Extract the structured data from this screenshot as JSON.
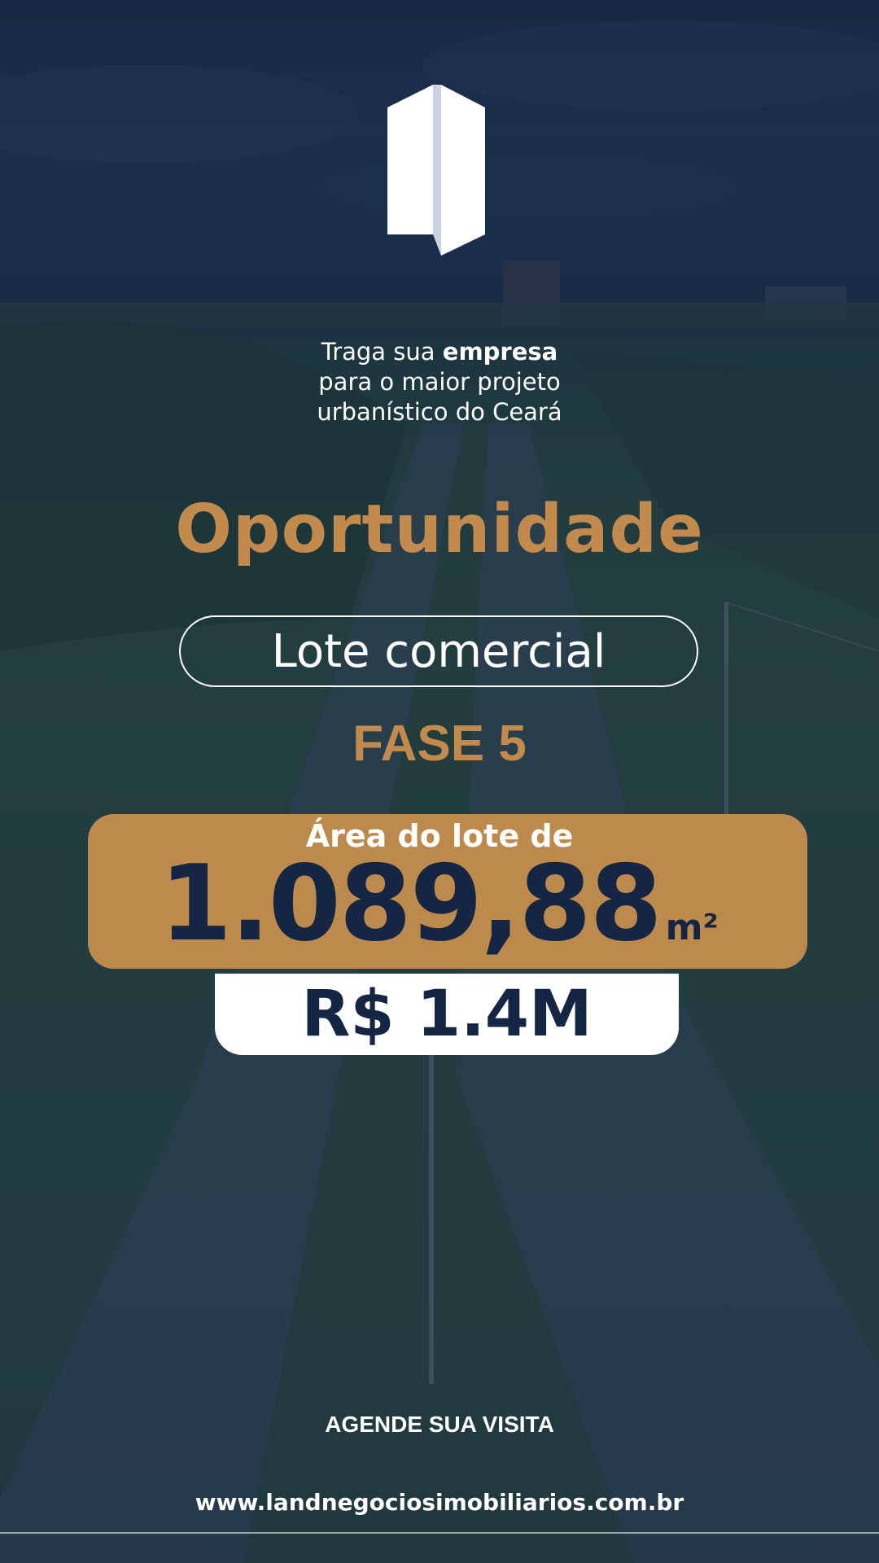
{
  "tagline": {
    "line1_prefix": "Traga sua ",
    "line1_bold": "empresa",
    "line2": "para o maior projeto",
    "line3": "urbanístico do Ceará"
  },
  "headline": "Oportunidade",
  "lot_type": "Lote comercial",
  "phase": "FASE 5",
  "area": {
    "label": "Área do lote de",
    "value": "1.089,88",
    "unit": "m²"
  },
  "price": "R$ 1.4M",
  "cta": "AGENDE SUA VISITA",
  "website": "www.landnegociosimobiliarios.com.br",
  "colors": {
    "gold": "#c28a4c",
    "gold_box": "#bd8a4d",
    "navy": "#152544",
    "white": "#ffffff"
  }
}
